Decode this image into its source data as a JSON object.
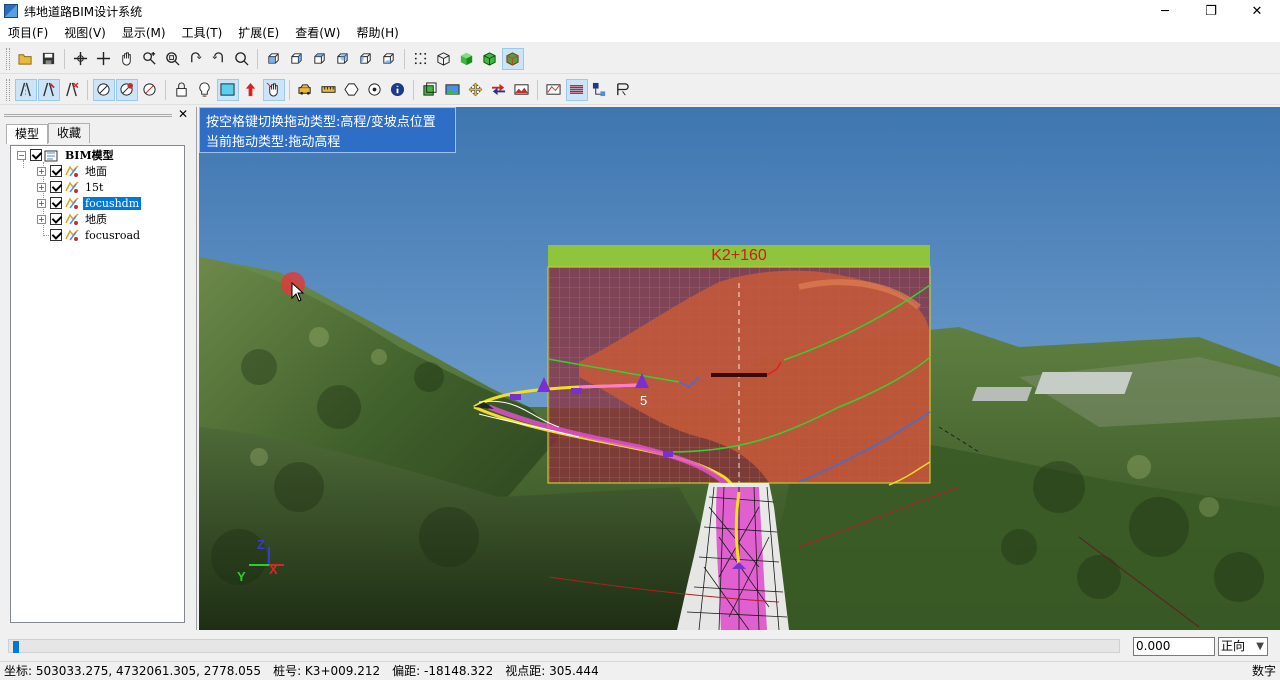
{
  "window": {
    "title": "纬地道路BIM设计系统",
    "minimize": "─",
    "maximize": "❐",
    "close": "✕"
  },
  "menu": [
    {
      "label": "项目(F)"
    },
    {
      "label": "视图(V)"
    },
    {
      "label": "显示(M)"
    },
    {
      "label": "工具(T)"
    },
    {
      "label": "扩展(E)"
    },
    {
      "label": "查看(W)"
    },
    {
      "label": "帮助(H)"
    }
  ],
  "left_panel": {
    "close": "✕",
    "tabs": [
      {
        "label": "模型",
        "active": true
      },
      {
        "label": "收藏",
        "active": false
      }
    ],
    "tree": {
      "root": {
        "label": "BIM模型",
        "checked": true,
        "expanded": true
      },
      "children": [
        {
          "label": "地面",
          "checked": true,
          "expander": "+"
        },
        {
          "label": "15t",
          "checked": true,
          "expander": "+"
        },
        {
          "label": "focushdm",
          "checked": true,
          "expander": "+",
          "selected": true
        },
        {
          "label": "地质",
          "checked": true,
          "expander": "+"
        },
        {
          "label": "focusroad",
          "checked": true,
          "expander": ""
        }
      ]
    }
  },
  "viewport": {
    "hint_line1": "按空格键切换拖动类型:高程/变坡点位置",
    "hint_line2": "当前拖动类型:拖动高程",
    "section_title": "K2+160",
    "point_label": "5",
    "axis_y": "Y",
    "axis_x": "X",
    "axis_z": "Z"
  },
  "bottom": {
    "coord_value": "0.000",
    "direction": "正向",
    "slider_fraction": 0.004
  },
  "status": {
    "coords": "坐标: 503033.275, 4732061.305, 2778.055",
    "station": "桩号: K3+009.212",
    "offset": "偏距: -18148.322",
    "view_distance": "视点距: 305.444",
    "mode": "数字"
  },
  "colors": {
    "accent": "#0078d7",
    "hint_bg": "#2e6ec6",
    "section_title": "#d21b1b",
    "section_band": "#8fc43c"
  }
}
